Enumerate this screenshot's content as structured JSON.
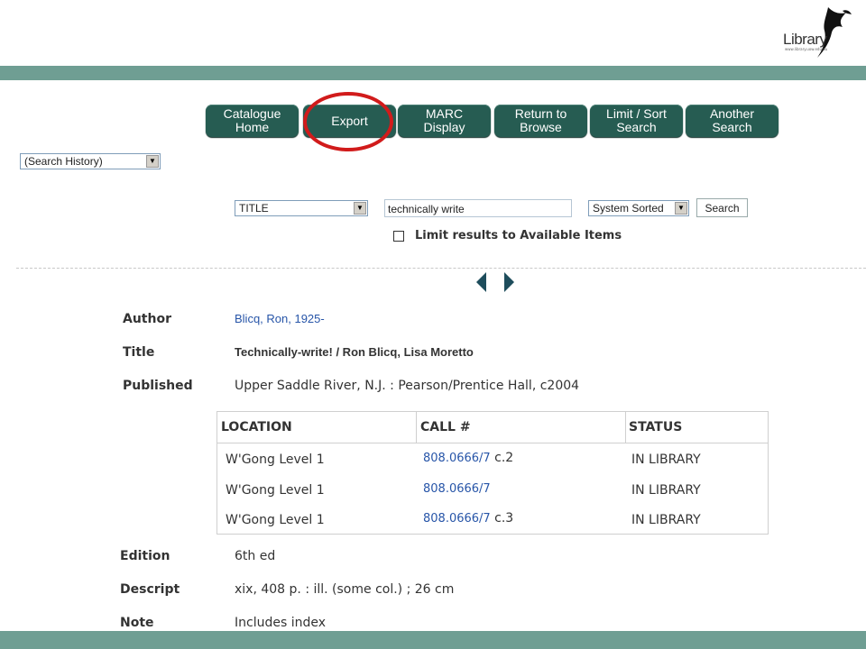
{
  "logo": {
    "text": "Library",
    "url": "www.library.uow.edu.au"
  },
  "nav": [
    {
      "label": "Catalogue\nHome"
    },
    {
      "label": "Export"
    },
    {
      "label": "MARC\nDisplay"
    },
    {
      "label": "Return to\nBrowse"
    },
    {
      "label": "Limit / Sort\nSearch"
    },
    {
      "label": "Another\nSearch"
    }
  ],
  "search_history": {
    "value": "(Search History)"
  },
  "search": {
    "field": "TITLE",
    "query": "technically write",
    "sort": "System Sorted",
    "button": "Search",
    "limit_label": "Limit results to Available Items",
    "limit_checked": false
  },
  "record": {
    "author_label": "Author",
    "author": "Blicq, Ron, 1925-",
    "title_label": "Title",
    "title": "Technically-write! / Ron Blicq, Lisa Moretto",
    "published_label": "Published",
    "published": "Upper Saddle River, N.J. : Pearson/Prentice Hall, c2004",
    "edition_label": "Edition",
    "edition": "6th ed",
    "descript_label": "Descript",
    "descript": "xix, 408 p. : ill. (some col.) ; 26 cm",
    "note_label": "Note",
    "note": "Includes index"
  },
  "holdings": {
    "headers": [
      "LOCATION",
      "CALL #",
      "STATUS"
    ],
    "rows": [
      {
        "location": "W'Gong Level 1",
        "call": "808.0666/7",
        "copy": " c.2",
        "status": "IN LIBRARY"
      },
      {
        "location": "W'Gong Level 1",
        "call": "808.0666/7",
        "copy": "",
        "status": "IN LIBRARY"
      },
      {
        "location": "W'Gong Level 1",
        "call": "808.0666/7",
        "copy": " c.3",
        "status": "IN LIBRARY"
      }
    ]
  },
  "colors": {
    "bar": "#6f9e93",
    "button": "#265c52",
    "highlight": "#d11b1b",
    "link": "#2755a8"
  },
  "icons": [
    "library-bird-logo-icon",
    "chevron-down-icon",
    "previous-arrow-icon",
    "next-arrow-icon"
  ]
}
